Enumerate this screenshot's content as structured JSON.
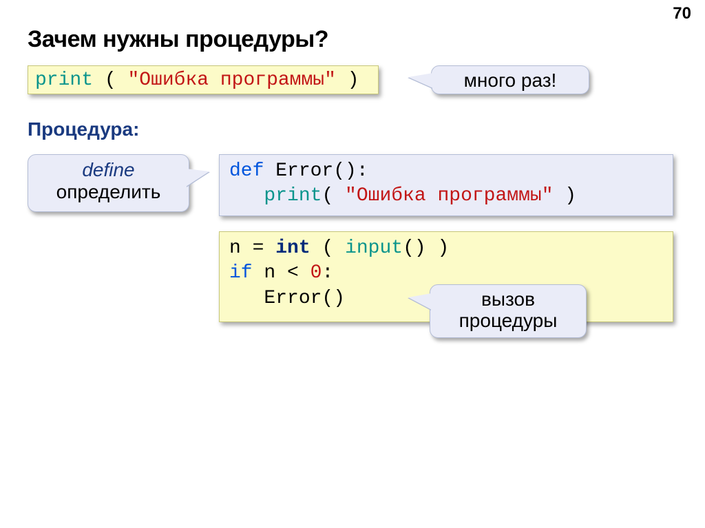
{
  "page_number": "70",
  "title": "Зачем нужны процедуры?",
  "subhead": "Процедура:",
  "callouts": {
    "many": "много раз!",
    "define_it": "define",
    "define_ru": "определить",
    "call_l1": "вызов",
    "call_l2": "процедуры"
  },
  "code1": {
    "print": "print",
    "open": " ( ",
    "str": "\"Ошибка программы\"",
    "close": " )"
  },
  "code2": {
    "def": "def",
    "name": " Error():",
    "indent": "   ",
    "print": "print",
    "open": "( ",
    "str": "\"Ошибка программы\"",
    "close": " )"
  },
  "code3": {
    "l1_a": "n = ",
    "l1_int": "int",
    "l1_b": " ( ",
    "l1_input": "input",
    "l1_c": "() )",
    "l2_if": "if",
    "l2_b": " n < ",
    "l2_zero": "0",
    "l2_c": ":",
    "l3": "   Error()"
  }
}
